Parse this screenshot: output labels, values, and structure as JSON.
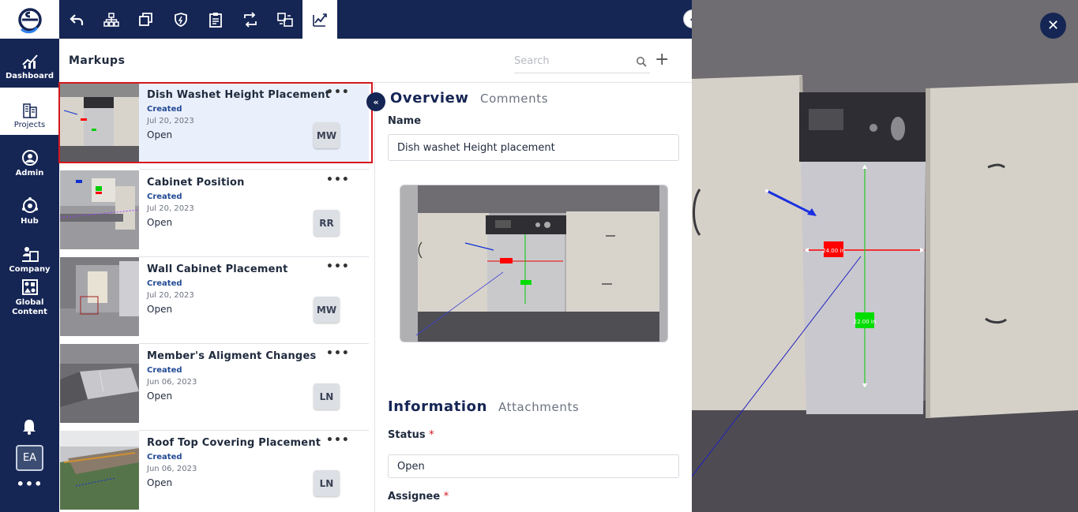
{
  "nav": {
    "items": [
      {
        "label": "Dashboard",
        "icon": "dashboard-icon"
      },
      {
        "label": "Projects",
        "icon": "projects-icon"
      },
      {
        "label": "Admin",
        "icon": "admin-icon"
      },
      {
        "label": "Hub",
        "icon": "hub-icon"
      },
      {
        "label": "Company",
        "icon": "company-icon"
      },
      {
        "label": "Global\nContent",
        "icon": "global-content-icon"
      }
    ],
    "user_initials": "EA",
    "more": "•••"
  },
  "toolbar": {
    "tools": [
      "undo-icon",
      "hierarchy-icon",
      "copy-icon",
      "shield-icon",
      "clipboard-icon",
      "sync-icon",
      "compare-icon",
      "markup-icon"
    ],
    "active_tool": "markup-icon",
    "collapse": "«"
  },
  "markups": {
    "title": "Markups",
    "search_placeholder": "Search",
    "add": "+",
    "items": [
      {
        "title": "Dish Washet Height Placement",
        "tag": "Created",
        "date": "Jul 20, 2023",
        "state": "Open",
        "initials": "MW",
        "menu": "•••"
      },
      {
        "title": "Cabinet Position",
        "tag": "Created",
        "date": "Jul 20, 2023",
        "state": "Open",
        "initials": "RR",
        "menu": "•••"
      },
      {
        "title": "Wall Cabinet Placement",
        "tag": "Created",
        "date": "Jul 20, 2023",
        "state": "Open",
        "initials": "MW",
        "menu": "•••"
      },
      {
        "title": "Member's Aligment Changes",
        "tag": "Created",
        "date": "Jun 06, 2023",
        "state": "Open",
        "initials": "LN",
        "menu": "•••"
      },
      {
        "title": "Roof Top Covering Placement",
        "tag": "Created",
        "date": "Jun 06, 2023",
        "state": "Open",
        "initials": "LN",
        "menu": "•••"
      }
    ]
  },
  "detail": {
    "collapse": "«",
    "tabs": {
      "overview": "Overview",
      "comments": "Comments"
    },
    "name_label": "Name",
    "name_value": "Dish washet Height placement",
    "info_tabs": {
      "information": "Information",
      "attachments": "Attachments"
    },
    "status_label": "Status",
    "status_value": "Open",
    "assignee_label": "Assignee",
    "required": "*",
    "preview_dims": {
      "width": "24.00 in",
      "height": "22.00 in"
    }
  },
  "viewer": {
    "close": "✕",
    "width_label": "24.00 in",
    "height_label": "22.00 in"
  },
  "colors": {
    "navy": "#152554",
    "accent_red": "#d5171e",
    "dim_red": "#ff0000",
    "dim_green": "#00dd00"
  }
}
